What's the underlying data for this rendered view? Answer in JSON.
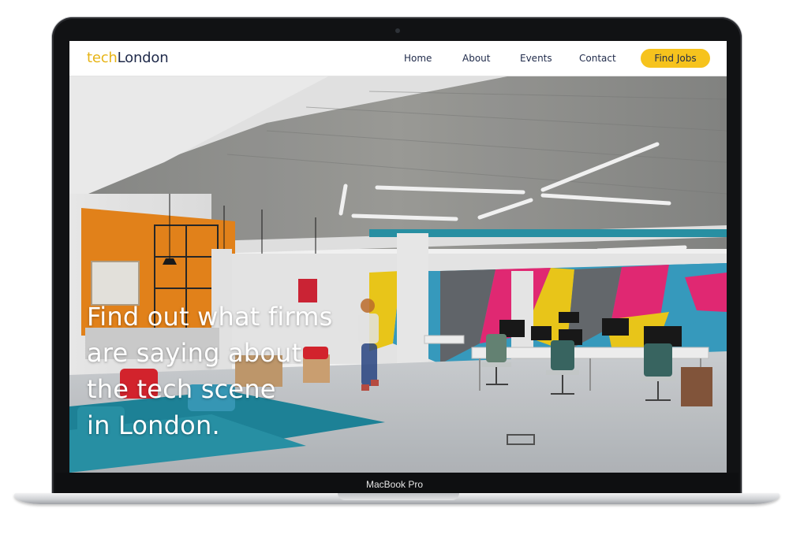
{
  "site": {
    "logo_prefix": "tech",
    "logo_suffix": "London"
  },
  "nav": {
    "items": [
      {
        "label": "Home"
      },
      {
        "label": "About"
      },
      {
        "label": "Events"
      },
      {
        "label": "Contact"
      }
    ],
    "cta_label": "Find Jobs"
  },
  "hero": {
    "headline_lines": [
      "Find out what firms",
      "are saying about",
      "the tech scene",
      "in London."
    ]
  },
  "device": {
    "label": "MacBook Pro"
  },
  "colors": {
    "brand_yellow": "#f6c31d",
    "brand_navy": "#1f2a4a"
  }
}
